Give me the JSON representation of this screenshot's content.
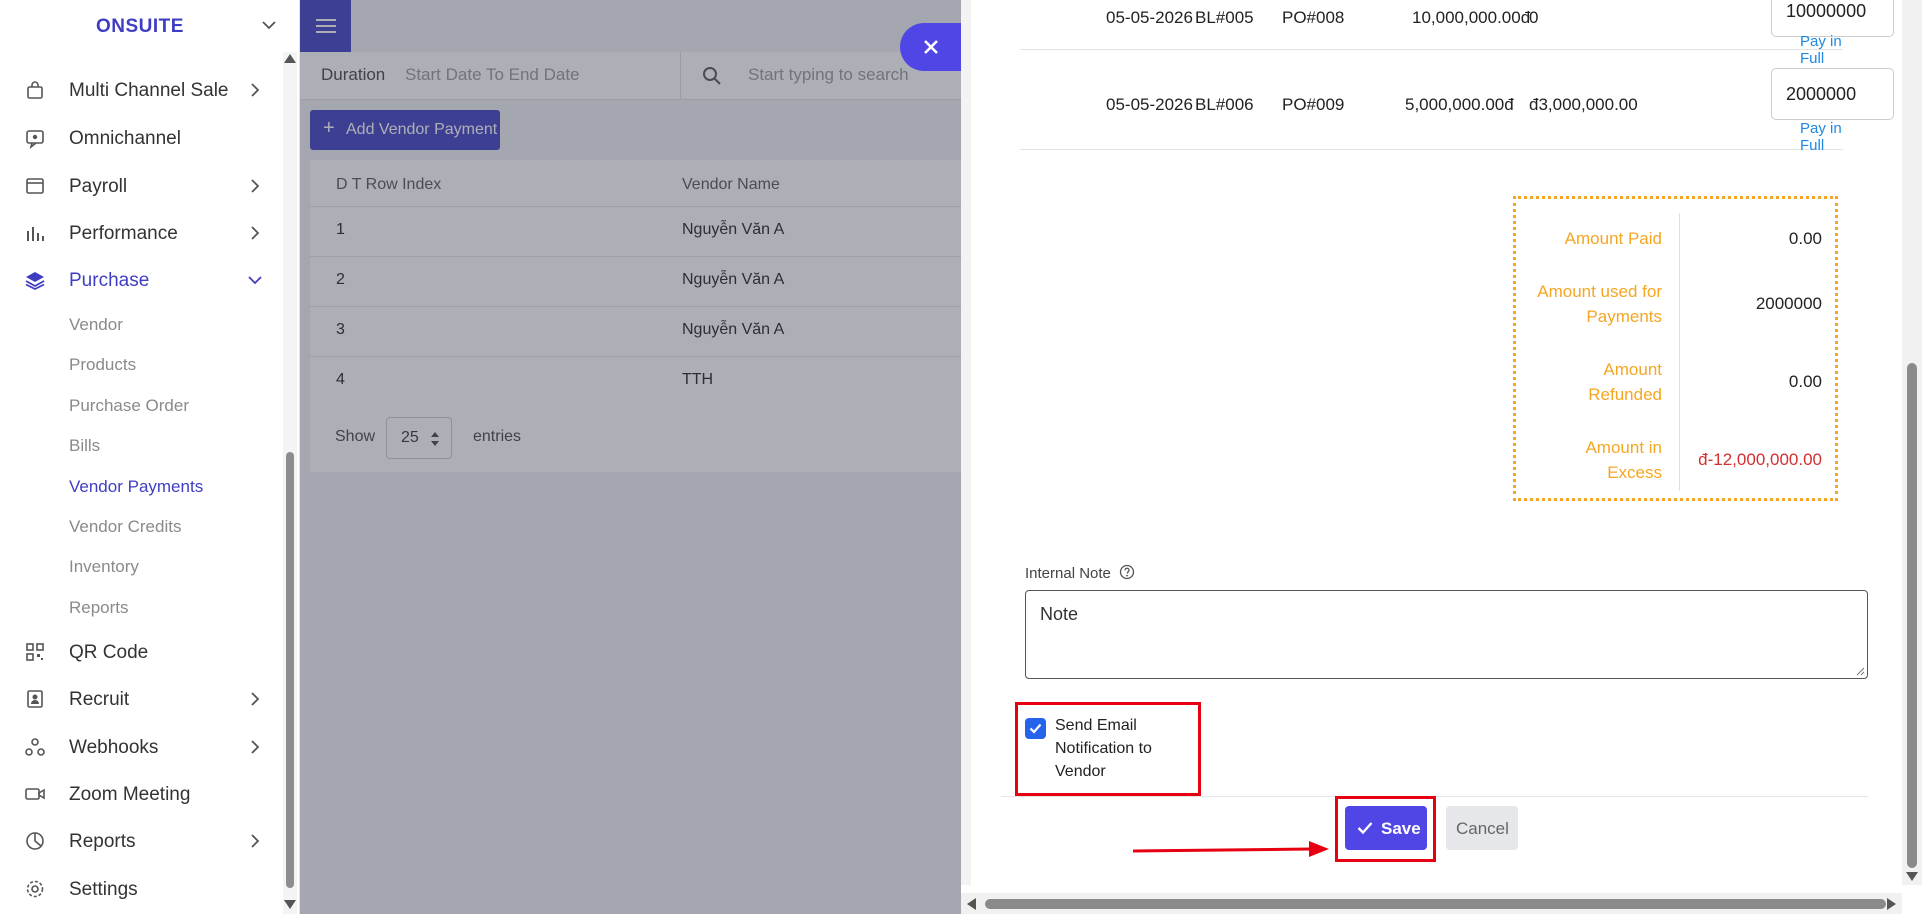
{
  "brand": {
    "name": "ONSUITE"
  },
  "sidebar": {
    "items": [
      {
        "label": "Multi Channel Sale",
        "icon": "bag-icon",
        "has_arrow": true
      },
      {
        "label": "Omnichannel",
        "icon": "omnichannel-icon",
        "has_arrow": false
      },
      {
        "label": "Payroll",
        "icon": "payroll-icon",
        "has_arrow": true
      },
      {
        "label": "Performance",
        "icon": "bar-chart-icon",
        "has_arrow": true
      },
      {
        "label": "Purchase",
        "icon": "layers-icon",
        "has_arrow": true,
        "active": true
      },
      {
        "label": "QR Code",
        "icon": "qr-code-icon",
        "has_arrow": false
      },
      {
        "label": "Recruit",
        "icon": "recruit-icon",
        "has_arrow": true
      },
      {
        "label": "Webhooks",
        "icon": "webhooks-icon",
        "has_arrow": true
      },
      {
        "label": "Zoom Meeting",
        "icon": "video-icon",
        "has_arrow": false
      },
      {
        "label": "Reports",
        "icon": "pie-chart-icon",
        "has_arrow": true
      },
      {
        "label": "Settings",
        "icon": "gear-icon",
        "has_arrow": false
      }
    ],
    "purchase_sub": [
      "Vendor",
      "Products",
      "Purchase Order",
      "Bills",
      "Vendor Payments",
      "Vendor Credits",
      "Inventory",
      "Reports"
    ],
    "active_sub": "Vendor Payments"
  },
  "topbar": {
    "duration_label": "Duration",
    "range_placeholder": "Start Date To End Date",
    "search_placeholder": "Start typing to search"
  },
  "list": {
    "add_button": "Add Vendor Payment",
    "columns": [
      "D T Row Index",
      "Vendor Name"
    ],
    "rows": [
      [
        "1",
        "Nguyễn Văn A"
      ],
      [
        "2",
        "Nguyễn Văn A"
      ],
      [
        "3",
        "Nguyễn Văn A"
      ],
      [
        "4",
        "TTH"
      ]
    ],
    "show_label": "Show",
    "page_size": "25",
    "entries_label": "entries"
  },
  "drawer": {
    "bill_rows": [
      {
        "date": "05-05-2026",
        "bill": "BL#005",
        "po": "PO#008",
        "amount": "10,000,000.00đ",
        "due": "0",
        "payment": "10000000",
        "pay_full": "Pay in Full"
      },
      {
        "date": "05-05-2026",
        "bill": "BL#006",
        "po": "PO#009",
        "amount": "5,000,000.00đ",
        "due": "đ3,000,000.00",
        "payment": "2000000",
        "pay_full": "Pay in Full"
      }
    ],
    "summary": {
      "amount_paid_label": "Amount Paid",
      "amount_paid": "0.00",
      "amount_used_label": "Amount used for Payments",
      "amount_used": "2000000",
      "amount_refunded_label": "Amount Refunded",
      "amount_refunded": "0.00",
      "amount_excess_label": "Amount in Excess",
      "amount_excess": "đ-12,000,000.00"
    },
    "internal_note_label": "Internal Note",
    "note_placeholder": "Note",
    "email_notification_label": "Send Email Notification to Vendor",
    "email_notification_checked": true,
    "save_label": "Save",
    "cancel_label": "Cancel"
  },
  "colors": {
    "primary": "#3f3ec2",
    "button": "#4f46e5",
    "summary_accent": "#f5a623",
    "annotation_red": "#e60012",
    "negative": "#d32f2f",
    "link": "#1e88e5"
  }
}
